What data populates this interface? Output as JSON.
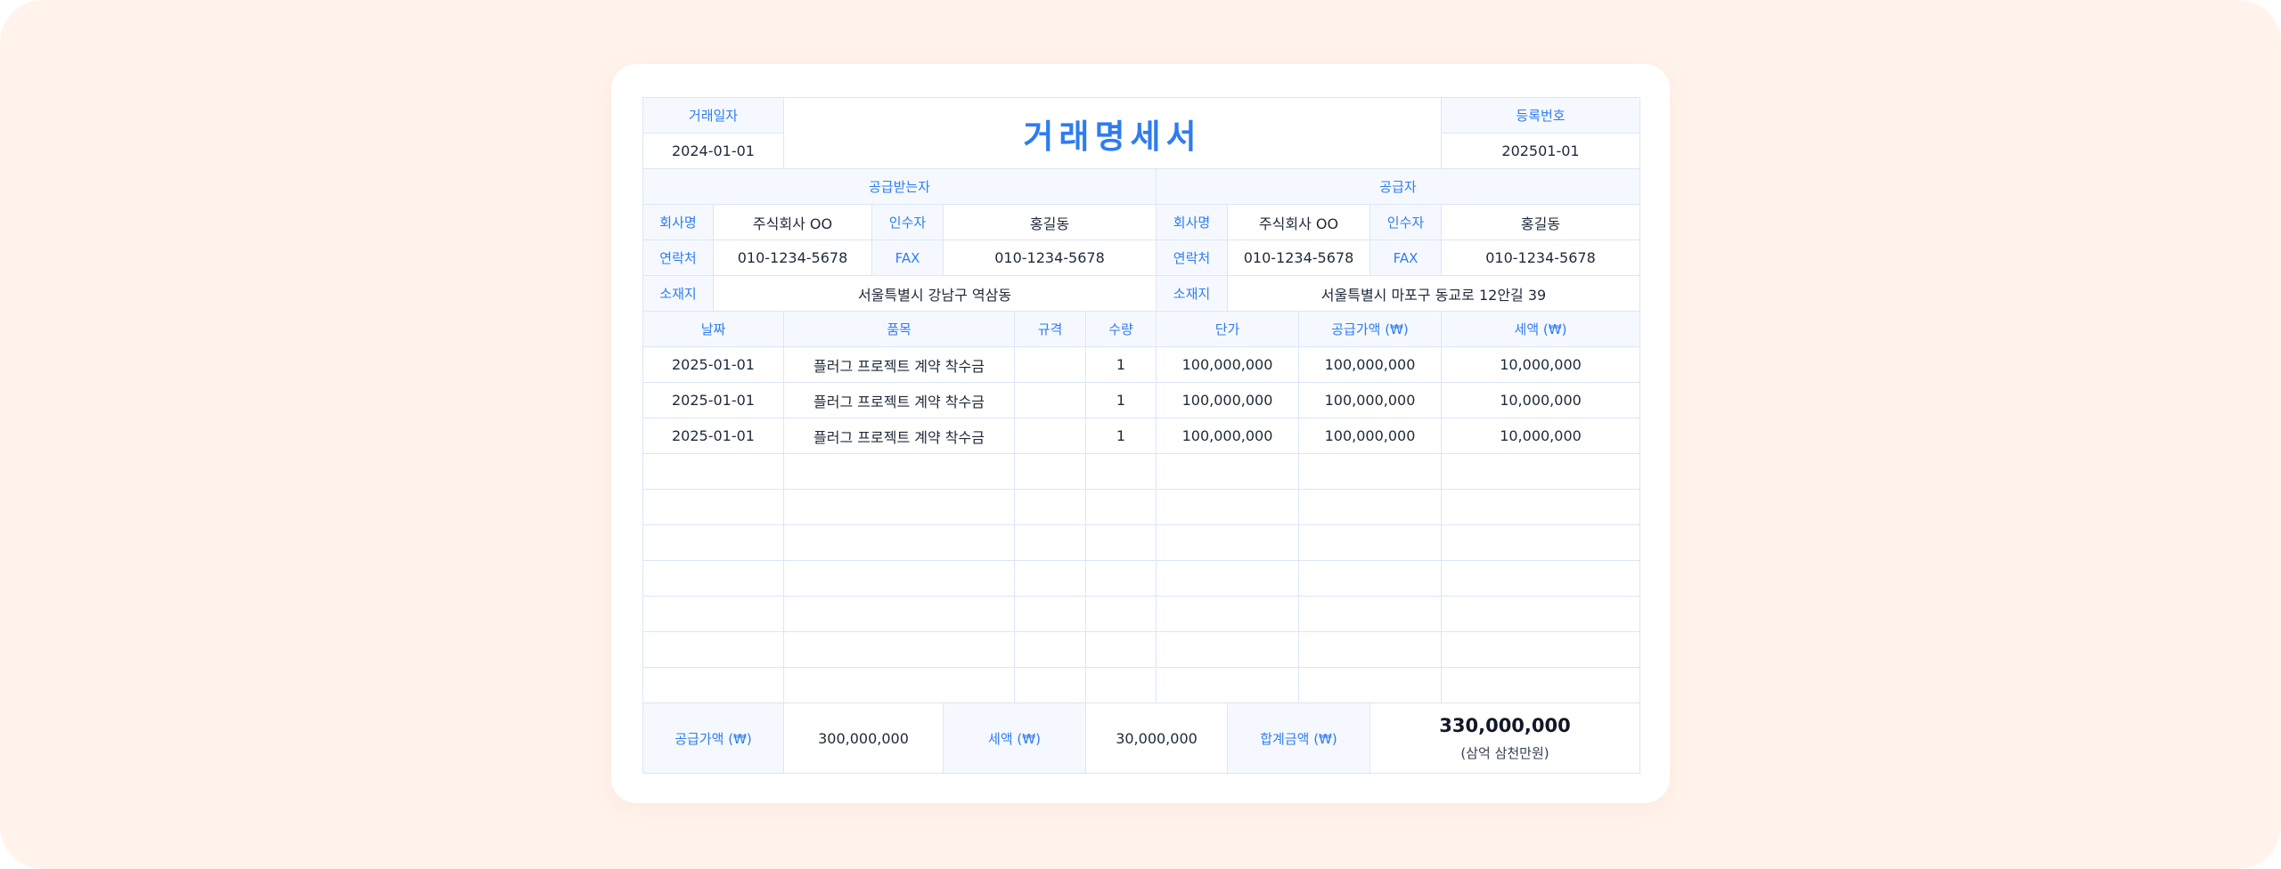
{
  "doc": {
    "title": "거래명세서",
    "trade_date_label": "거래일자",
    "trade_date": "2024-01-01",
    "reg_no_label": "등록번호",
    "reg_no": "202501-01"
  },
  "buyer": {
    "section_label": "공급받는자",
    "company_label": "회사명",
    "company": "주식회사 OO",
    "recipient_label": "인수자",
    "recipient": "홍길동",
    "phone_label": "연락처",
    "phone": "010-1234-5678",
    "fax_label": "FAX",
    "fax": "010-1234-5678",
    "address_label": "소재지",
    "address": "서울특별시 강남구 역삼동"
  },
  "supplier": {
    "section_label": "공급자",
    "company_label": "회사명",
    "company": "주식회사 OO",
    "recipient_label": "인수자",
    "recipient": "홍길동",
    "phone_label": "연락처",
    "phone": "010-1234-5678",
    "fax_label": "FAX",
    "fax": "010-1234-5678",
    "address_label": "소재지",
    "address": "서울특별시 마포구 동교로 12안길 39"
  },
  "items": {
    "headers": {
      "date": "날짜",
      "item": "품목",
      "spec": "규격",
      "qty": "수량",
      "unit_price": "단가",
      "supply": "공급가액 (₩)",
      "tax": "세액 (₩)"
    },
    "rows": [
      {
        "date": "2025-01-01",
        "item": "플러그 프로젝트 계약 착수금",
        "spec": "",
        "qty": "1",
        "unit_price": "100,000,000",
        "supply": "100,000,000",
        "tax": "10,000,000"
      },
      {
        "date": "2025-01-01",
        "item": "플러그 프로젝트 계약 착수금",
        "spec": "",
        "qty": "1",
        "unit_price": "100,000,000",
        "supply": "100,000,000",
        "tax": "10,000,000"
      },
      {
        "date": "2025-01-01",
        "item": "플러그 프로젝트 계약 착수금",
        "spec": "",
        "qty": "1",
        "unit_price": "100,000,000",
        "supply": "100,000,000",
        "tax": "10,000,000"
      },
      {
        "date": "",
        "item": "",
        "spec": "",
        "qty": "",
        "unit_price": "",
        "supply": "",
        "tax": ""
      },
      {
        "date": "",
        "item": "",
        "spec": "",
        "qty": "",
        "unit_price": "",
        "supply": "",
        "tax": ""
      },
      {
        "date": "",
        "item": "",
        "spec": "",
        "qty": "",
        "unit_price": "",
        "supply": "",
        "tax": ""
      },
      {
        "date": "",
        "item": "",
        "spec": "",
        "qty": "",
        "unit_price": "",
        "supply": "",
        "tax": ""
      },
      {
        "date": "",
        "item": "",
        "spec": "",
        "qty": "",
        "unit_price": "",
        "supply": "",
        "tax": ""
      },
      {
        "date": "",
        "item": "",
        "spec": "",
        "qty": "",
        "unit_price": "",
        "supply": "",
        "tax": ""
      },
      {
        "date": "",
        "item": "",
        "spec": "",
        "qty": "",
        "unit_price": "",
        "supply": "",
        "tax": ""
      }
    ]
  },
  "totals": {
    "supply_label": "공급가액 (₩)",
    "supply": "300,000,000",
    "tax_label": "세액 (₩)",
    "tax": "30,000,000",
    "total_label": "합계금액 (₩)",
    "total": "330,000,000",
    "total_words": "(삼억 삼천만원)"
  },
  "colors": {
    "accent": "#2f7cf0",
    "header_bg": "#f5f9ff",
    "border": "#dbe6f5",
    "page_bg": "#fff3ec"
  }
}
